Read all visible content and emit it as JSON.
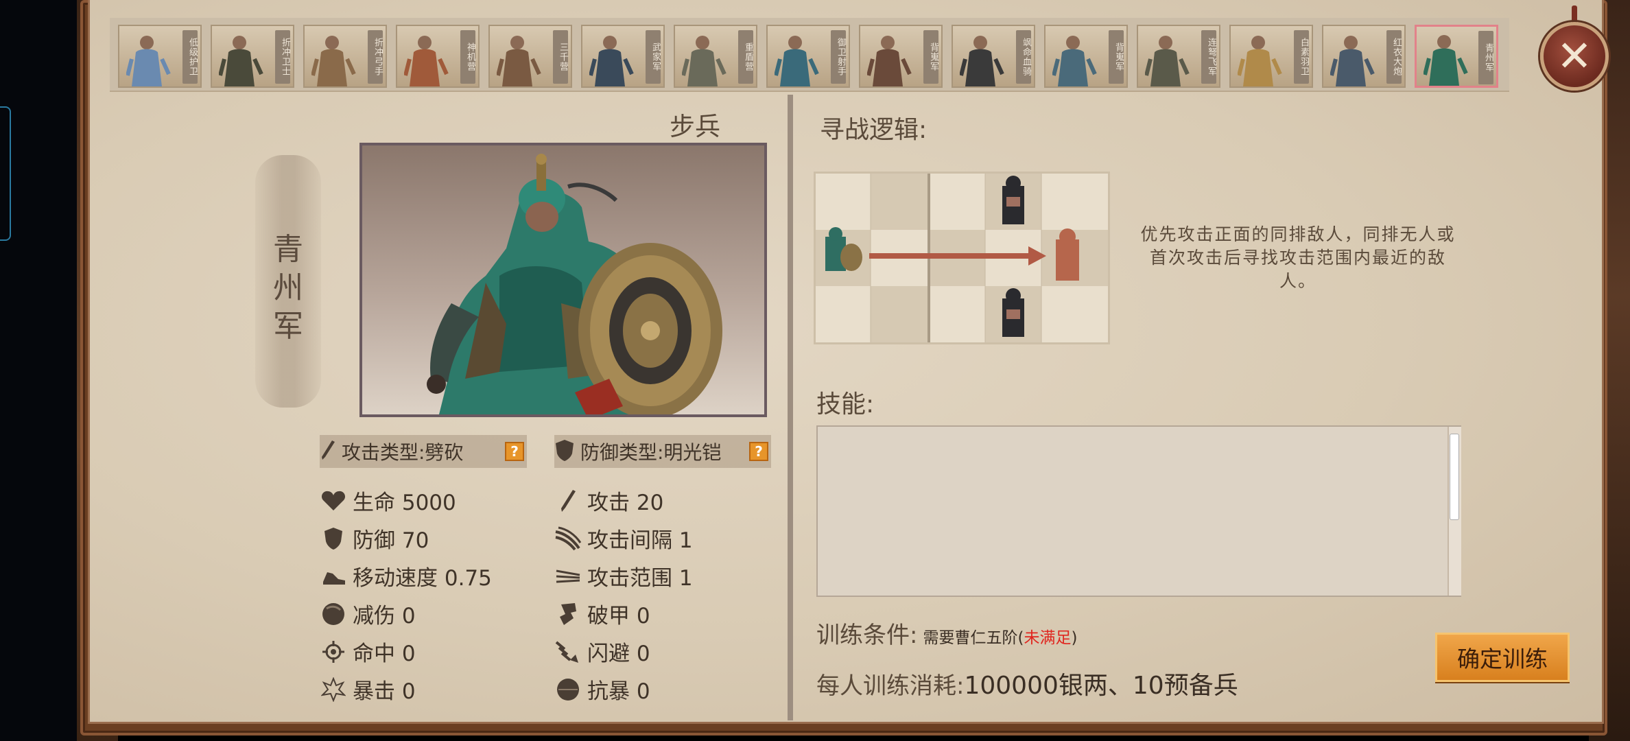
{
  "tabs": [
    {
      "label": "低级护卫"
    },
    {
      "label": "折冲卫士"
    },
    {
      "label": "折冲弓手"
    },
    {
      "label": "神机营"
    },
    {
      "label": "三千营"
    },
    {
      "label": "武家军"
    },
    {
      "label": "重盾营"
    },
    {
      "label": "御卫射手"
    },
    {
      "label": "背嵬军"
    },
    {
      "label": "飒命血骑"
    },
    {
      "label": "背嵬军"
    },
    {
      "label": "连弩飞军"
    },
    {
      "label": "白素羽卫"
    },
    {
      "label": "红衣大炮"
    },
    {
      "label": "青州军",
      "active": true
    }
  ],
  "unit": {
    "type": "步兵",
    "name": "青州军",
    "attack_type": "攻击类型:劈砍",
    "defense_type": "防御类型:明光铠",
    "help": "?"
  },
  "stats": {
    "hp": "生命 5000",
    "attack": "攻击 20",
    "defense": "防御 70",
    "attack_interval": "攻击间隔 1",
    "move_speed": "移动速度 0.75",
    "attack_range": "攻击范围 1",
    "damage_reduction": "减伤 0",
    "armor_break": "破甲 0",
    "hit": "命中 0",
    "dodge": "闪避 0",
    "crit": "暴击 0",
    "crit_resist": "抗暴 0"
  },
  "logic": {
    "title": "寻战逻辑:",
    "description": "优先攻击正面的同排敌人，同排无人或首次攻击后寻找攻击范围内最近的敌人。"
  },
  "skills": {
    "title": "技能:"
  },
  "training": {
    "condition_label": "训练条件:",
    "requirement": "需要曹仁五阶(",
    "unmet": "未满足",
    "close_paren": ")",
    "cost_label": "每人训练消耗:",
    "cost_value": "100000银两、10预备兵",
    "confirm": "确定训练"
  },
  "close": "✕",
  "colors": {
    "panel_bg": "#d9cbb4",
    "frame": "#6b3f22",
    "accent_button": "#e7952a",
    "unmet_text": "#e0261f",
    "arrow": "#b15a45"
  }
}
